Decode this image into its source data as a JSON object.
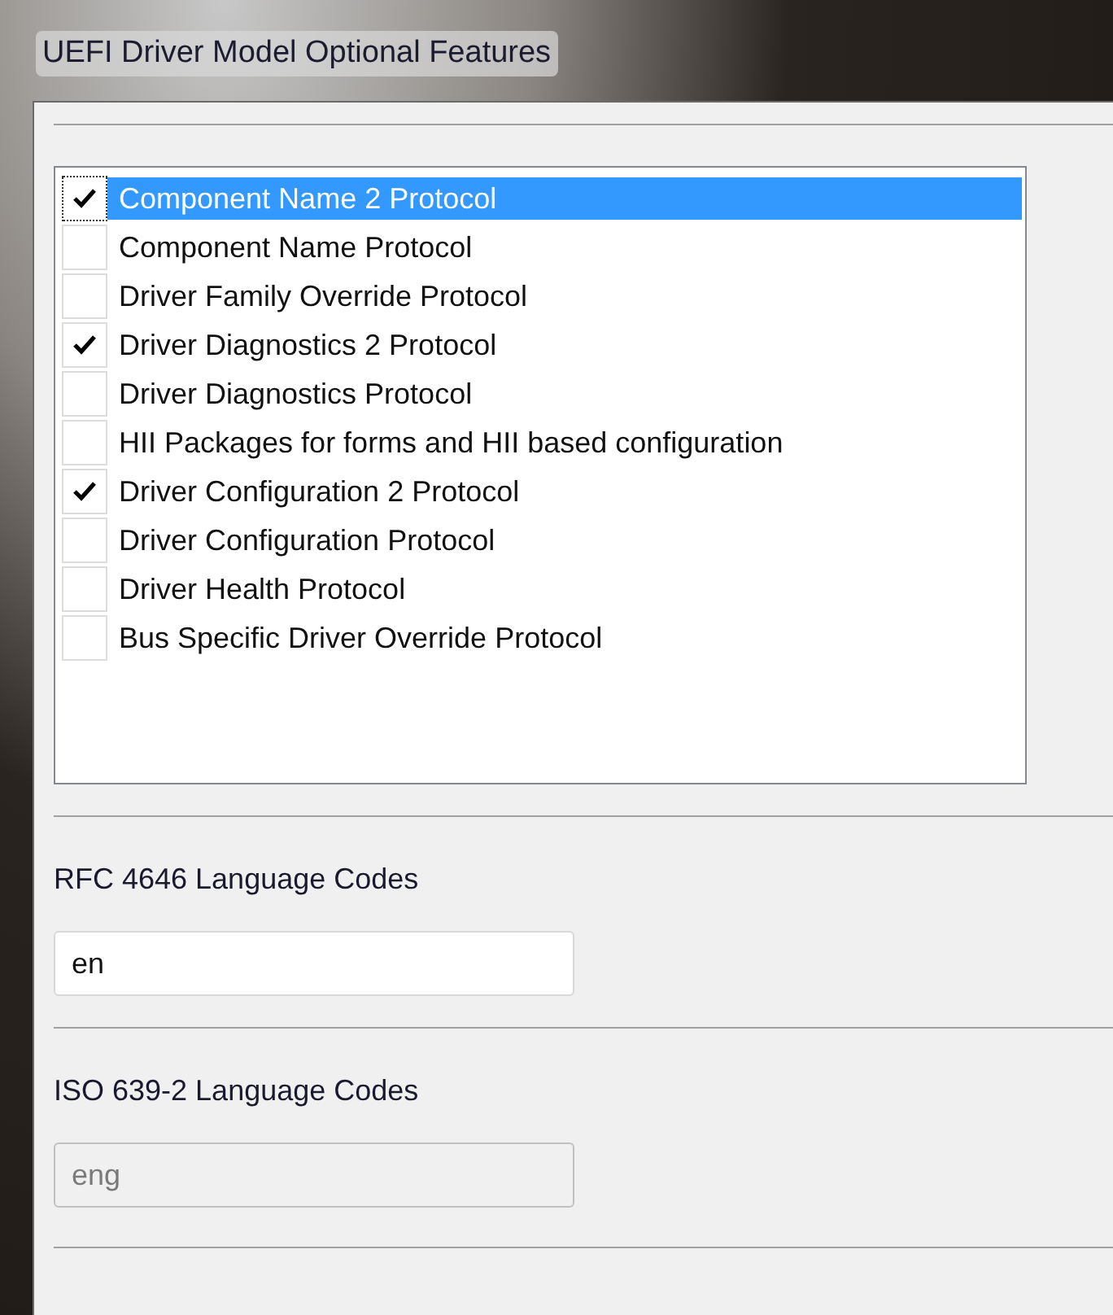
{
  "window": {
    "title": "UEFI Driver Model Optional Features"
  },
  "features": [
    {
      "label": "Component Name 2 Protocol",
      "checked": true,
      "selected": true
    },
    {
      "label": "Component Name Protocol",
      "checked": false,
      "selected": false
    },
    {
      "label": "Driver Family Override Protocol",
      "checked": false,
      "selected": false
    },
    {
      "label": "Driver Diagnostics 2 Protocol",
      "checked": true,
      "selected": false
    },
    {
      "label": "Driver Diagnostics Protocol",
      "checked": false,
      "selected": false
    },
    {
      "label": "HII Packages for forms and HII based configuration",
      "checked": false,
      "selected": false
    },
    {
      "label": "Driver Configuration 2 Protocol",
      "checked": true,
      "selected": false
    },
    {
      "label": "Driver Configuration Protocol",
      "checked": false,
      "selected": false
    },
    {
      "label": "Driver Health Protocol",
      "checked": false,
      "selected": false
    },
    {
      "label": "Bus Specific Driver Override Protocol",
      "checked": false,
      "selected": false
    }
  ],
  "fields": [
    {
      "label": "RFC 4646 Language Codes",
      "value": "en",
      "disabled": false
    },
    {
      "label": "ISO 639-2 Language Codes",
      "value": "eng",
      "disabled": true
    }
  ]
}
